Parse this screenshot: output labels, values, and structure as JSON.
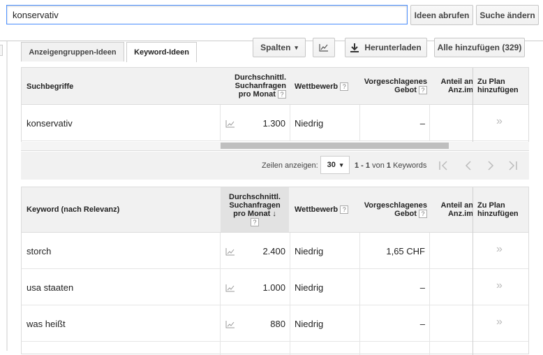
{
  "search": {
    "value": "konservativ"
  },
  "buttons": {
    "ideas": "Ideen abrufen",
    "change": "Suche ändern"
  },
  "tabs": [
    {
      "label": "Anzeigengruppen-Ideen"
    },
    {
      "label": "Keyword-Ideen"
    }
  ],
  "toolbar": {
    "columns": "Spalten",
    "download": "Herunterladen",
    "add_all": "Alle hinzufügen (329)"
  },
  "table1": {
    "headers": {
      "term": "Suchbegriffe",
      "avg_searches": "Durchschnittl. Suchanfragen pro Monat",
      "competition": "Wettbewerb",
      "suggested_bid": "Vorgeschlagenes Gebot",
      "share": "Anteil an Anz.im",
      "add_plan": "Zu Plan hinzufügen"
    },
    "rows": [
      {
        "term": "konservativ",
        "avg": "1.300",
        "competition": "Niedrig",
        "bid": "–"
      }
    ]
  },
  "pager": {
    "rows_label": "Zeilen anzeigen:",
    "rows_value": "30",
    "range": "1 - 1",
    "of_label": "von",
    "total": "1",
    "unit": "Keywords"
  },
  "table2": {
    "headers": {
      "term": "Keyword (nach Relevanz)",
      "avg_searches": "Durchschnittl. Suchanfragen pro Monat",
      "competition": "Wettbewerb",
      "suggested_bid": "Vorgeschlagenes Gebot",
      "share": "Anteil an Anz.im",
      "add_plan": "Zu Plan hinzufügen"
    },
    "rows": [
      {
        "term": "storch",
        "avg": "2.400",
        "competition": "Niedrig",
        "bid": "1,65 CHF"
      },
      {
        "term": "usa staaten",
        "avg": "1.000",
        "competition": "Niedrig",
        "bid": "–"
      },
      {
        "term": "was heißt",
        "avg": "880",
        "competition": "Niedrig",
        "bid": "–"
      }
    ]
  },
  "icons": {
    "help": "?",
    "add": "»",
    "sort": "↓",
    "dropdown": "▾"
  }
}
